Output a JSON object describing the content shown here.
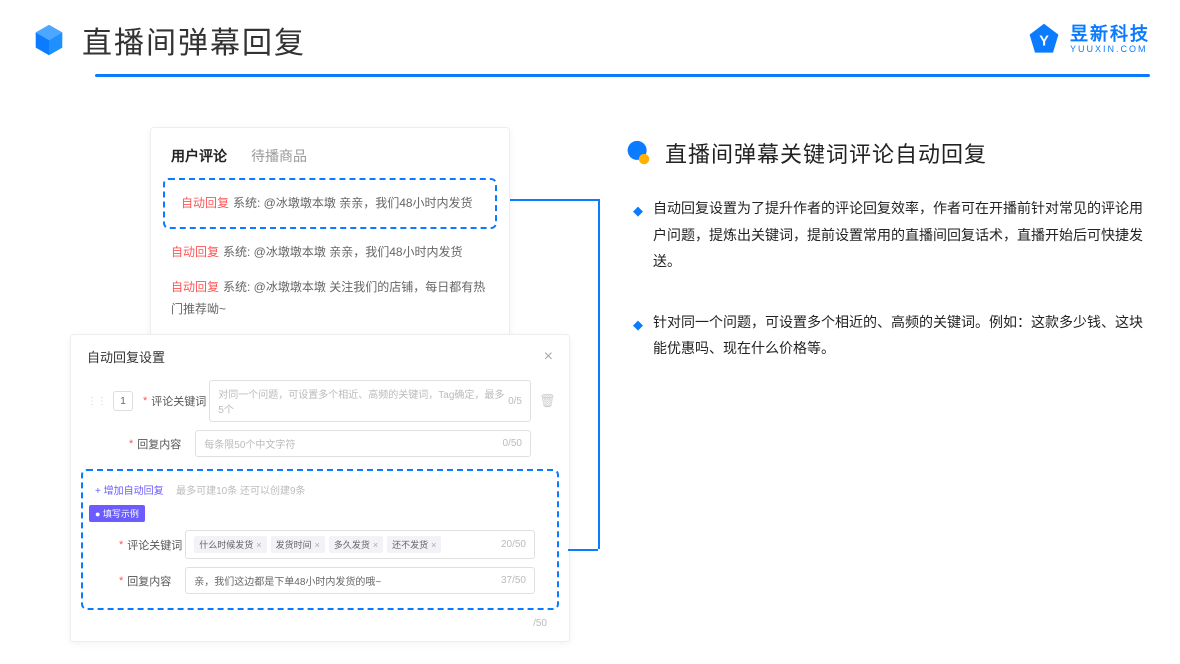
{
  "header": {
    "title": "直播间弹幕回复",
    "brand_name": "昱新科技",
    "brand_sub": "YUUXIN.COM"
  },
  "card1": {
    "tab_active": "用户评论",
    "tab_inactive": "待播商品",
    "comments": [
      {
        "prefix": "自动回复",
        "text": "系统: @冰墩墩本墩 亲亲，我们48小时内发货"
      },
      {
        "prefix": "自动回复",
        "text": "系统: @冰墩墩本墩 亲亲，我们48小时内发货"
      },
      {
        "prefix": "自动回复",
        "text": "系统: @冰墩墩本墩 关注我们的店铺，每日都有热门推荐呦~"
      }
    ]
  },
  "card2": {
    "title": "自动回复设置",
    "row1_num": "1",
    "label_keyword": "评论关键词",
    "placeholder_keyword": "对同一个问题，可设置多个相近、高频的关键词，Tag确定，最多5个",
    "count_keyword": "0/5",
    "label_content": "回复内容",
    "placeholder_content": "每条限50个中文字符",
    "count_content": "0/50",
    "add_label": "+ 增加自动回复",
    "add_hint": "最多可建10条 还可以创建9条",
    "example_badge": "● 填写示例",
    "example_tags": [
      "什么时候发货",
      "发货时间",
      "多久发货",
      "还不发货"
    ],
    "example_tag_count": "20/50",
    "example_content": "亲，我们这边都是下单48小时内发货的哦~",
    "example_content_count": "37/50",
    "trailing_count": "/50"
  },
  "section": {
    "title": "直播间弹幕关键词评论自动回复",
    "bullets": [
      "自动回复设置为了提升作者的评论回复效率，作者可在开播前针对常见的评论用户问题，提炼出关键词，提前设置常用的直播间回复话术，直播开始后可快捷发送。",
      "针对同一个问题，可设置多个相近的、高频的关键词。例如：这款多少钱、这块能优惠吗、现在什么价格等。"
    ]
  }
}
